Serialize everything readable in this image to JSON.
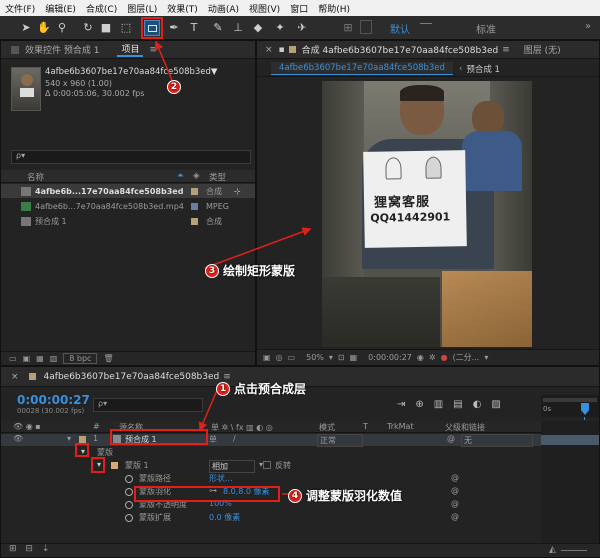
{
  "menu": [
    "文件(F)",
    "编辑(E)",
    "合成(C)",
    "图层(L)",
    "效果(T)",
    "动画(A)",
    "视图(V)",
    "窗口",
    "帮助(H)"
  ],
  "toolbar": {
    "workspace_default": "默认",
    "workspace_standard": "标准",
    "more": "»"
  },
  "project_panel": {
    "tab_effects": "效果控件 预合成 1",
    "tab_project": "项目",
    "footage_name": "4afbe6b3607be17e70aa84fce508b3ed▼",
    "footage_size": "540 x 960 (1.00)",
    "footage_duration": "Δ 0:00:05:06, 30.002 fps",
    "search_placeholder": "ρ▾",
    "col_name": "名称",
    "col_type": "类型",
    "items": [
      {
        "name": "4afbe6b...17e70aa84fce508b3ed",
        "type": "合成"
      },
      {
        "name": "4afbe6b...7e70aa84fce508b3ed.mp4",
        "type": "MPEG"
      },
      {
        "name": "预合成 1",
        "type": "合成"
      }
    ],
    "bpc": "8 bpc"
  },
  "comp_panel": {
    "tab_comp": "合成 4afbe6b3607be17e70aa84fce508b3ed",
    "tab_layer": "图层 (无)",
    "sub_tab_comp": "4afbe6b3607be17e70aa84fce508b3ed",
    "sub_tab_precomp": "预合成 1",
    "sign_line1": "狸窝客服",
    "sign_line2": "QQ41442901",
    "zoom": "50%",
    "timecode": "0:00:00:27",
    "resolution": "(二分..."
  },
  "timeline": {
    "tab_name": "4afbe6b3607be17e70aa84fce508b3ed",
    "timecode": "0:00:00:27",
    "frame_info": "00028 (30.002 fps)",
    "col_num": "#",
    "col_source": "源名称",
    "col_mode": "模式",
    "col_trkmat": "TrkMat",
    "col_parent": "父级和链接",
    "ruler_start": "0s",
    "layer1_num": "1",
    "layer1_name": "预合成 1",
    "layer1_mode": "正常",
    "layer1_parent": "无",
    "masks_label": "蒙版",
    "mask1_name": "蒙版 1",
    "mask1_mode": "相加",
    "mask1_invert": "反转",
    "prop_path": "蒙版路径",
    "prop_path_val": "形状...",
    "prop_feather": "蒙版羽化",
    "prop_feather_val": "8.0,8.0 像素",
    "prop_opacity": "蒙版不透明度",
    "prop_opacity_val": "100%",
    "prop_expansion": "蒙版扩展",
    "prop_expansion_val": "0.0 像素"
  },
  "annotations": {
    "a1": "点击预合成层",
    "a2": "",
    "a3": "绘制矩形蒙版",
    "a4": "调整蒙版羽化数值",
    "n1": "1",
    "n2": "2",
    "n3": "3",
    "n4": "4"
  },
  "colors": {
    "accent": "#3a8fd9",
    "annotation": "#e0201a"
  }
}
